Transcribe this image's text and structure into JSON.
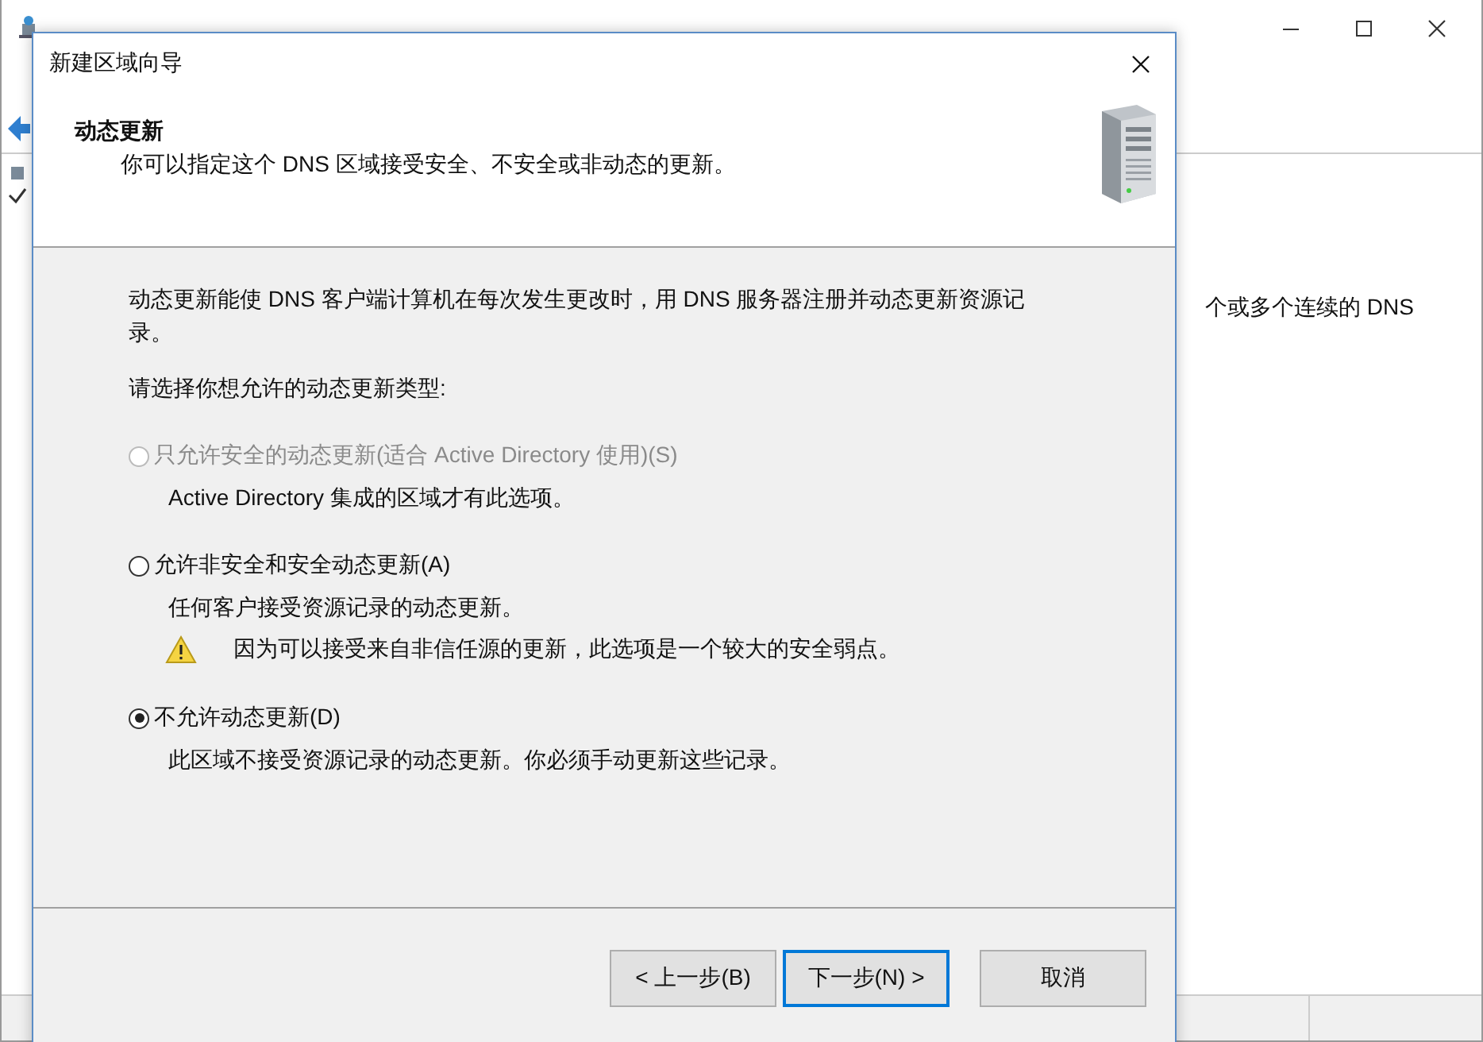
{
  "background_window": {
    "content_text": "个或多个连续的 DNS"
  },
  "dialog": {
    "title": "新建区域向导",
    "header": {
      "heading": "动态更新",
      "subtitle": "你可以指定这个 DNS 区域接受安全、不安全或非动态的更新。"
    },
    "intro": "动态更新能使 DNS 客户端计算机在每次发生更改时，用 DNS 服务器注册并动态更新资源记录。",
    "prompt": "请选择你想允许的动态更新类型:",
    "options": [
      {
        "label": "只允许安全的动态更新(适合 Active Directory 使用)(S)",
        "description": "Active Directory 集成的区域才有此选项。",
        "selected": false,
        "disabled": true
      },
      {
        "label": "允许非安全和安全动态更新(A)",
        "description": "任何客户接受资源记录的动态更新。",
        "warning": "因为可以接受来自非信任源的更新，此选项是一个较大的安全弱点。",
        "selected": false,
        "disabled": false
      },
      {
        "label": "不允许动态更新(D)",
        "description": "此区域不接受资源记录的动态更新。你必须手动更新这些记录。",
        "selected": true,
        "disabled": false
      }
    ],
    "buttons": [
      {
        "label": "< 上一步(B)",
        "default": false
      },
      {
        "label": "下一步(N) >",
        "default": true
      },
      {
        "label": "取消",
        "default": false
      }
    ]
  }
}
